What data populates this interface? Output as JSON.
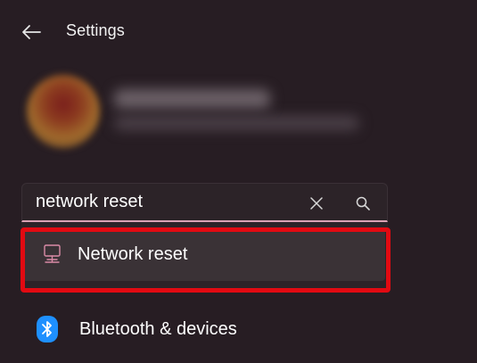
{
  "window": {
    "title": "Settings",
    "back_icon": "back-arrow-icon"
  },
  "search": {
    "value": "network reset",
    "clear_icon": "close-icon",
    "search_icon": "search-icon",
    "accent_color": "#d9a1b3"
  },
  "results": [
    {
      "label": "Network reset",
      "icon": "network-computer-icon",
      "highlight_color": "#e20a12"
    }
  ],
  "nav": {
    "items": [
      {
        "label": "Bluetooth & devices",
        "icon": "bluetooth-icon",
        "icon_color": "#1e90ff"
      }
    ]
  }
}
